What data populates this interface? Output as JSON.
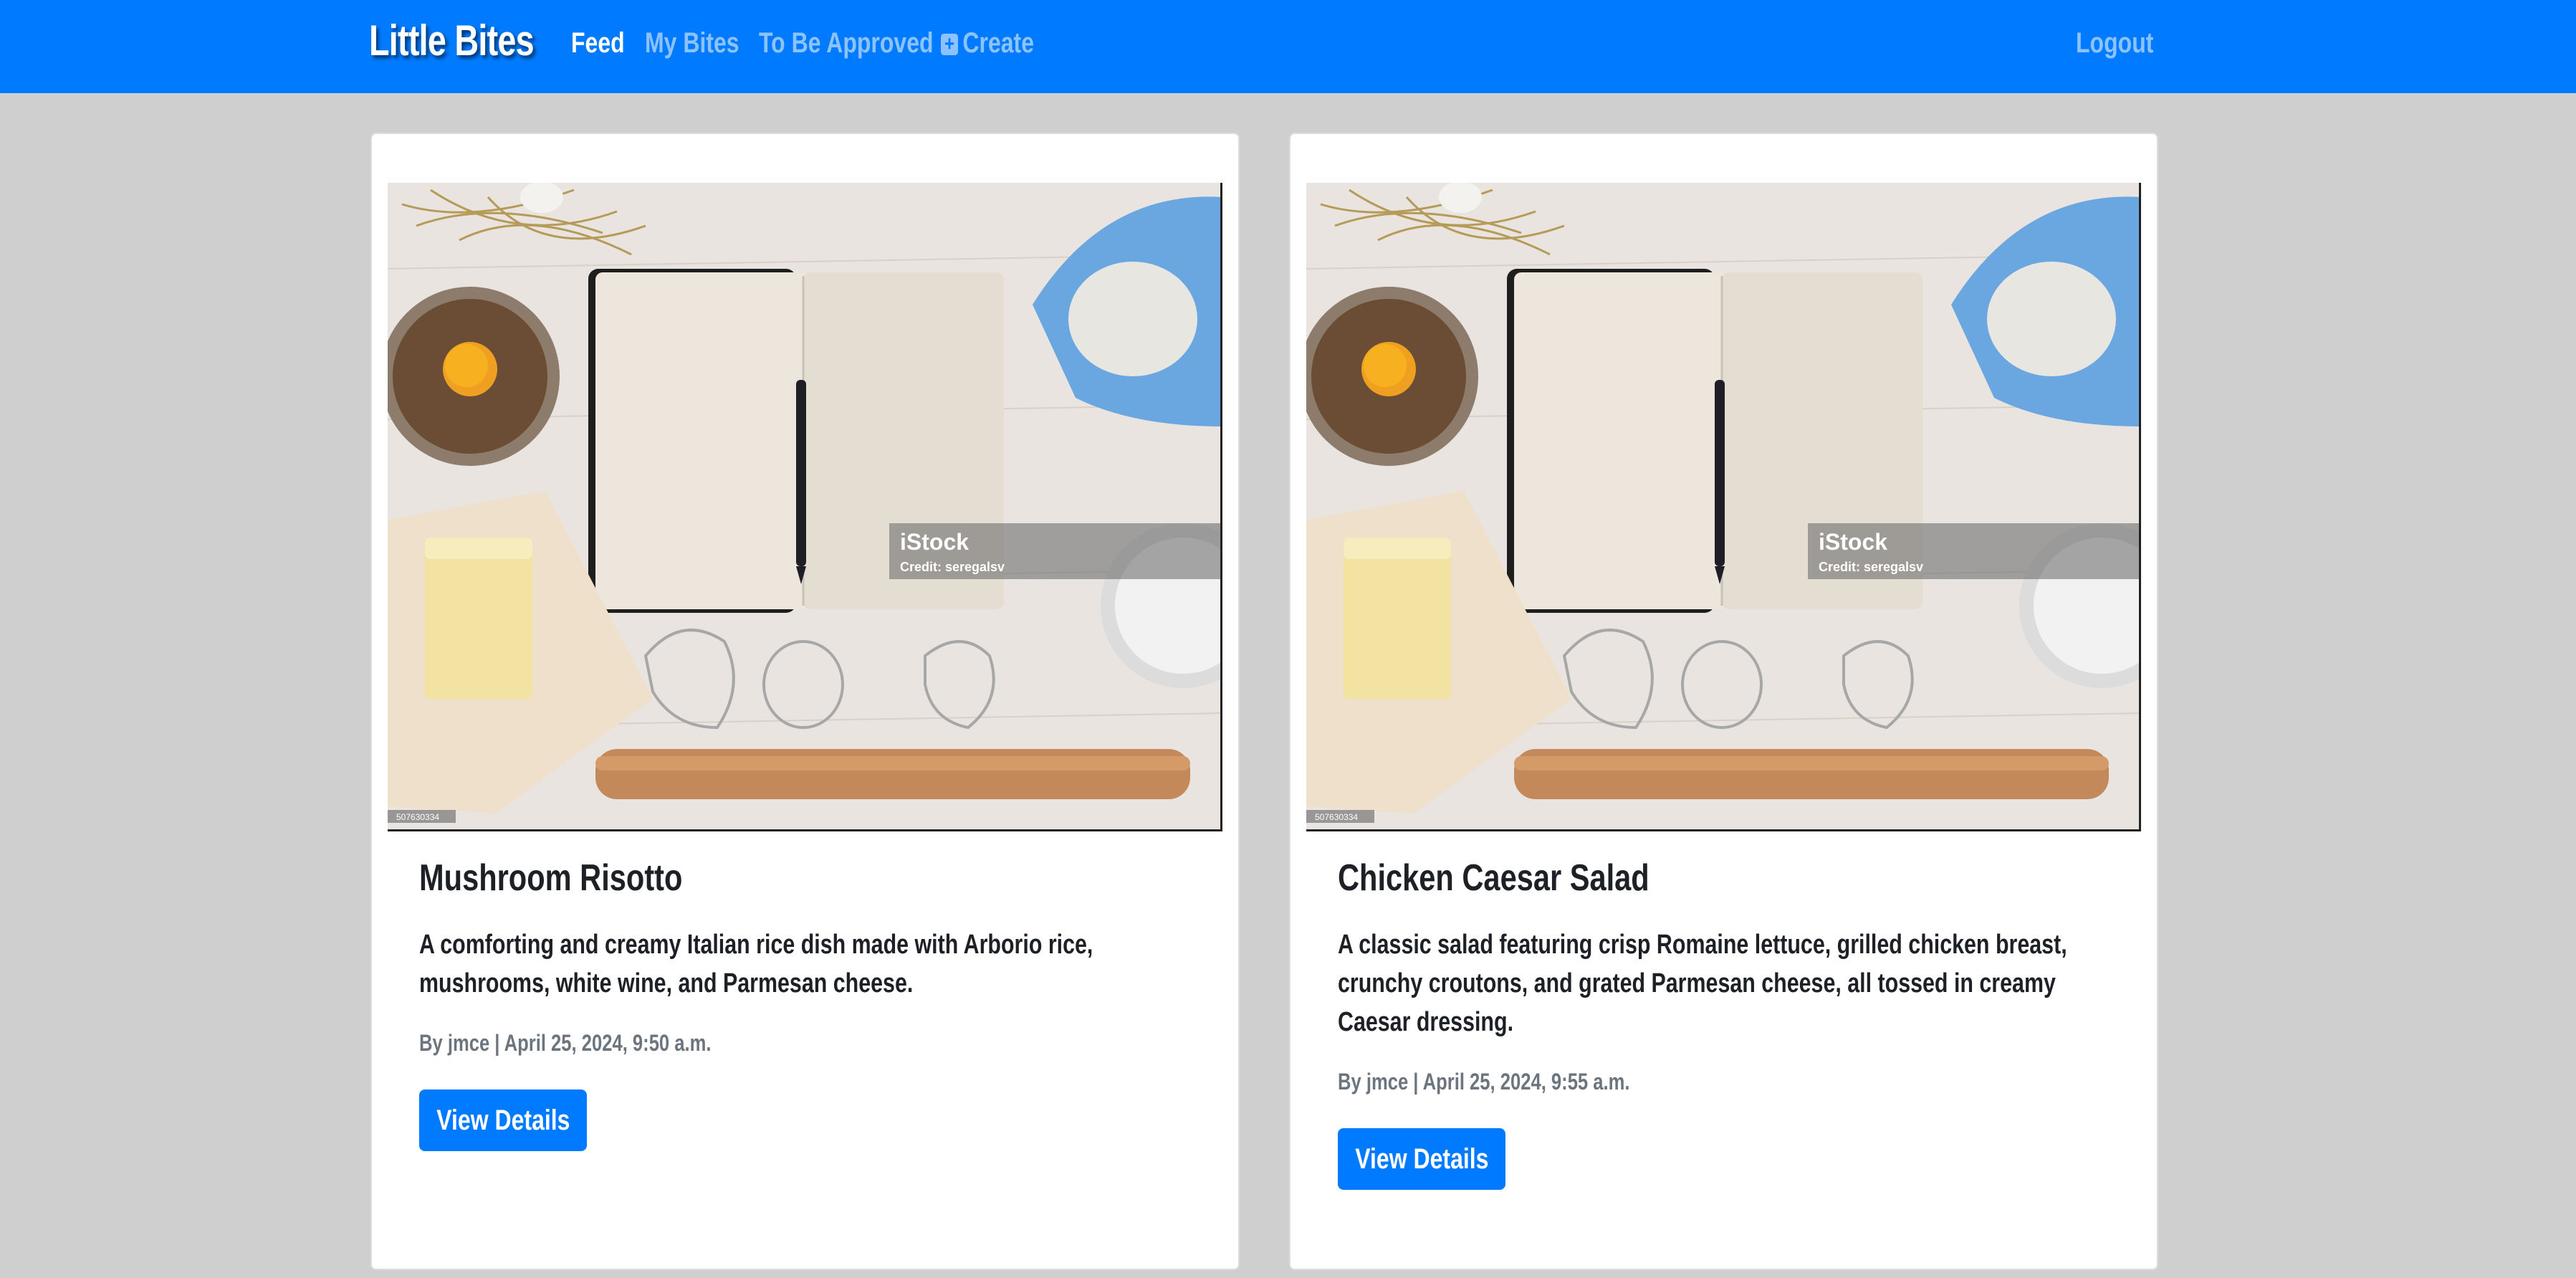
{
  "nav": {
    "brand": "Little Bites",
    "links": [
      {
        "label": "Feed",
        "active": true
      },
      {
        "label": "My Bites",
        "active": false
      },
      {
        "label": "To Be Approved",
        "active": false
      },
      {
        "label": "Create",
        "active": false,
        "icon": "plus-square-icon"
      }
    ],
    "logout": "Logout"
  },
  "colors": {
    "navbar": "#007bff",
    "background": "#cfcfcf",
    "button": "#007bff"
  },
  "posts": [
    {
      "title": "Mushroom Risotto",
      "description": "A comforting and creamy Italian rice dish made with Arborio rice, mushrooms, white wine, and Parmesan cheese.",
      "meta": "By jmce | April 25, 2024, 9:50 a.m.",
      "button": "View Details",
      "image": {
        "watermark": "iStock",
        "credit": "Credit: seregalsv",
        "id": "507630334"
      }
    },
    {
      "title": "Chicken Caesar Salad",
      "description": "A classic salad featuring crisp Romaine lettuce, grilled chicken breast, crunchy croutons, and grated Parmesan cheese, all tossed in creamy Caesar dressing.",
      "meta": "By jmce | April 25, 2024, 9:55 a.m.",
      "button": "View Details",
      "image": {
        "watermark": "iStock",
        "credit": "Credit: seregalsv",
        "id": "507630334"
      }
    }
  ]
}
